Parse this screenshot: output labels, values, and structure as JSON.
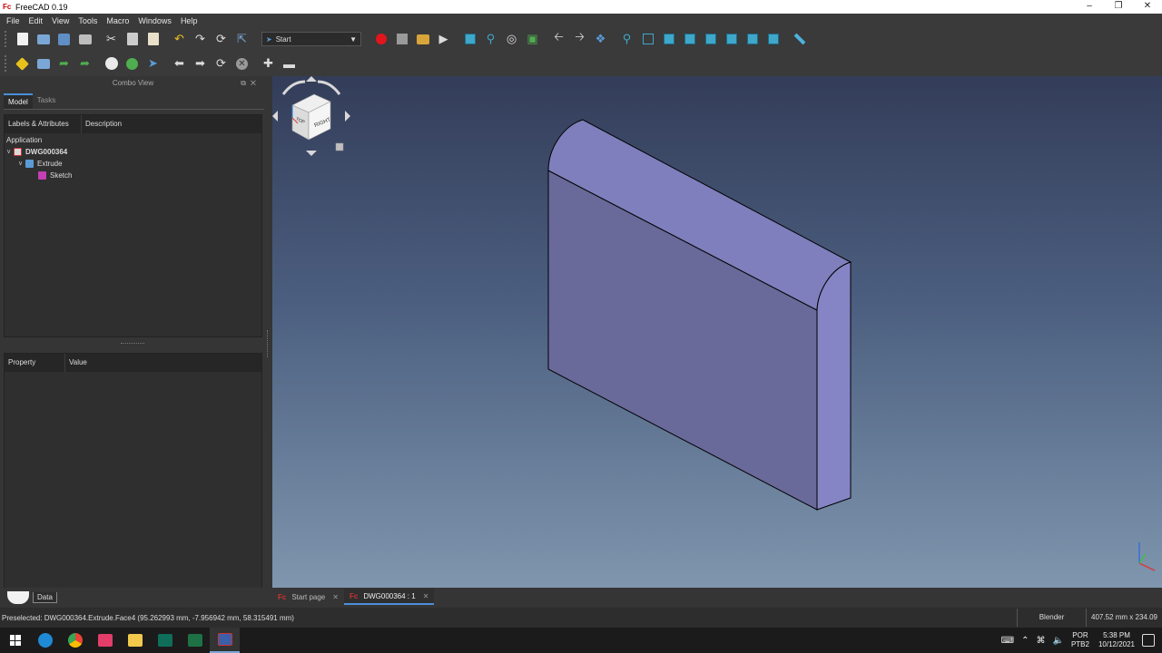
{
  "window": {
    "title": "FreeCAD 0.19",
    "app_icon": "Fc"
  },
  "menu": [
    "File",
    "Edit",
    "View",
    "Tools",
    "Macro",
    "Windows",
    "Help"
  ],
  "workbench": {
    "selected": "Start"
  },
  "combo_view": {
    "title": "Combo View",
    "tabs": [
      "Model",
      "Tasks"
    ],
    "tree_headers": [
      "Labels & Attributes",
      "Description"
    ],
    "tree": {
      "section": "Application",
      "document": "DWG000364",
      "feature": "Extrude",
      "child": "Sketch"
    },
    "property_headers": [
      "Property",
      "Value"
    ],
    "bottom_tab": "Data"
  },
  "viewport": {
    "background_top": "#333d59",
    "background_bottom": "#7f96ae",
    "solid_front_color": "#69699a",
    "solid_top_color": "#7e7fbc",
    "solid_side_color": "#8585c6",
    "navcube_label": "RIGHT",
    "navcube_top_label": "TOP"
  },
  "document_tabs": [
    {
      "label": "Start page",
      "active": false
    },
    {
      "label": "DWG000364 : 1",
      "active": true
    }
  ],
  "statusbar": {
    "message": "Preselected: DWG000364.Extrude.Face4 (95.262993 mm, -7.956942 mm, 58.315491 mm)",
    "navigation_style": "Blender",
    "dimensions": "407.52 mm x 234.09 mm"
  },
  "taskbar": {
    "language": "POR",
    "layout": "PTB2",
    "time": "5:38 PM",
    "date": "10/12/2021"
  }
}
